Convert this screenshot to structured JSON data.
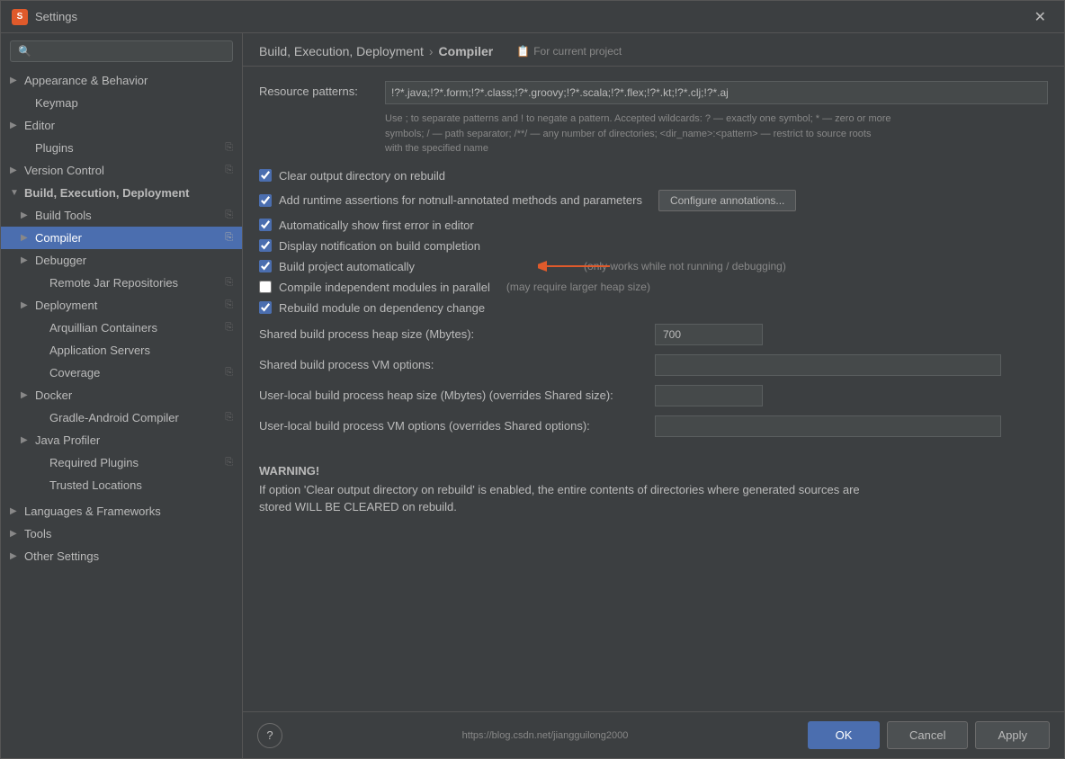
{
  "window": {
    "title": "Settings",
    "icon": "S"
  },
  "search": {
    "placeholder": ""
  },
  "sidebar": {
    "items": [
      {
        "id": "appearance",
        "label": "Appearance & Behavior",
        "indent": 0,
        "arrow": "▶",
        "expanded": false,
        "has_copy": false
      },
      {
        "id": "keymap",
        "label": "Keymap",
        "indent": 1,
        "arrow": "",
        "expanded": false,
        "has_copy": false
      },
      {
        "id": "editor",
        "label": "Editor",
        "indent": 0,
        "arrow": "▶",
        "expanded": false,
        "has_copy": false
      },
      {
        "id": "plugins",
        "label": "Plugins",
        "indent": 1,
        "arrow": "",
        "expanded": false,
        "has_copy": true
      },
      {
        "id": "version-control",
        "label": "Version Control",
        "indent": 0,
        "arrow": "▶",
        "expanded": false,
        "has_copy": true
      },
      {
        "id": "build-execution",
        "label": "Build, Execution, Deployment",
        "indent": 0,
        "arrow": "▼",
        "expanded": true,
        "has_copy": false
      },
      {
        "id": "build-tools",
        "label": "Build Tools",
        "indent": 1,
        "arrow": "▶",
        "expanded": false,
        "has_copy": true
      },
      {
        "id": "compiler",
        "label": "Compiler",
        "indent": 1,
        "arrow": "▶",
        "expanded": false,
        "has_copy": true,
        "selected": true
      },
      {
        "id": "debugger",
        "label": "Debugger",
        "indent": 1,
        "arrow": "▶",
        "expanded": false,
        "has_copy": false
      },
      {
        "id": "remote-jar",
        "label": "Remote Jar Repositories",
        "indent": 2,
        "arrow": "",
        "expanded": false,
        "has_copy": true
      },
      {
        "id": "deployment",
        "label": "Deployment",
        "indent": 1,
        "arrow": "▶",
        "expanded": false,
        "has_copy": true
      },
      {
        "id": "arquillian",
        "label": "Arquillian Containers",
        "indent": 2,
        "arrow": "",
        "expanded": false,
        "has_copy": true
      },
      {
        "id": "app-servers",
        "label": "Application Servers",
        "indent": 2,
        "arrow": "",
        "expanded": false,
        "has_copy": false
      },
      {
        "id": "coverage",
        "label": "Coverage",
        "indent": 2,
        "arrow": "",
        "expanded": false,
        "has_copy": true
      },
      {
        "id": "docker",
        "label": "Docker",
        "indent": 1,
        "arrow": "▶",
        "expanded": false,
        "has_copy": false
      },
      {
        "id": "gradle-android",
        "label": "Gradle-Android Compiler",
        "indent": 2,
        "arrow": "",
        "expanded": false,
        "has_copy": true
      },
      {
        "id": "java-profiler",
        "label": "Java Profiler",
        "indent": 1,
        "arrow": "▶",
        "expanded": false,
        "has_copy": false
      },
      {
        "id": "required-plugins",
        "label": "Required Plugins",
        "indent": 2,
        "arrow": "",
        "expanded": false,
        "has_copy": true
      },
      {
        "id": "trusted-locations",
        "label": "Trusted Locations",
        "indent": 2,
        "arrow": "",
        "expanded": false,
        "has_copy": false
      },
      {
        "id": "languages",
        "label": "Languages & Frameworks",
        "indent": 0,
        "arrow": "▶",
        "expanded": false,
        "has_copy": false
      },
      {
        "id": "tools",
        "label": "Tools",
        "indent": 0,
        "arrow": "▶",
        "expanded": false,
        "has_copy": false
      },
      {
        "id": "other-settings",
        "label": "Other Settings",
        "indent": 0,
        "arrow": "▶",
        "expanded": false,
        "has_copy": false
      }
    ]
  },
  "header": {
    "breadcrumb1": "Build, Execution, Deployment",
    "breadcrumb_arrow": "›",
    "breadcrumb2": "Compiler",
    "for_project_icon": "📋",
    "for_project_label": "For current project"
  },
  "content": {
    "resource_patterns_label": "Resource patterns:",
    "resource_patterns_value": "!?*.java;!?*.form;!?*.class;!?*.groovy;!?*.scala;!?*.flex;!?*.kt;!?*.clj;!?*.aj",
    "help_text": "Use ; to separate patterns and ! to negate a pattern. Accepted wildcards: ? — exactly one symbol; * — zero or more\nsymbols; / — path separator; /**/ — any number of directories; <dir_name>:<pattern> — restrict to source roots\nwith the specified name",
    "options": [
      {
        "id": "clear-output",
        "label": "Clear output directory on rebuild",
        "checked": true,
        "note": ""
      },
      {
        "id": "add-runtime",
        "label": "Add runtime assertions for notnull-annotated methods and parameters",
        "checked": true,
        "note": "",
        "has_button": true,
        "button_label": "Configure annotations..."
      },
      {
        "id": "auto-show-error",
        "label": "Automatically show first error in editor",
        "checked": true,
        "note": ""
      },
      {
        "id": "display-notification",
        "label": "Display notification on build completion",
        "checked": true,
        "note": ""
      },
      {
        "id": "build-auto",
        "label": "Build project automatically",
        "checked": true,
        "note": "(only works while not running / debugging)",
        "has_arrow": true
      },
      {
        "id": "compile-parallel",
        "label": "Compile independent modules in parallel",
        "checked": false,
        "note": "(may require larger heap size)"
      },
      {
        "id": "rebuild-module",
        "label": "Rebuild module on dependency change",
        "checked": true,
        "note": ""
      }
    ],
    "fields": [
      {
        "id": "heap-size-shared",
        "label": "Shared build process heap size (Mbytes):",
        "value": "700",
        "wide": false
      },
      {
        "id": "vm-options-shared",
        "label": "Shared build process VM options:",
        "value": "",
        "wide": true
      },
      {
        "id": "heap-size-local",
        "label": "User-local build process heap size (Mbytes) (overrides Shared size):",
        "value": "",
        "wide": false
      },
      {
        "id": "vm-options-local",
        "label": "User-local build process VM options (overrides Shared options):",
        "value": "",
        "wide": true
      }
    ],
    "warning_title": "WARNING!",
    "warning_text": "If option 'Clear output directory on rebuild' is enabled, the entire contents of directories where generated sources are\nstored WILL BE CLEARED on rebuild."
  },
  "footer": {
    "url": "https://blog.csdn.net/jiangguilong2000",
    "ok_label": "OK",
    "cancel_label": "Cancel",
    "apply_label": "Apply",
    "help_label": "?"
  }
}
